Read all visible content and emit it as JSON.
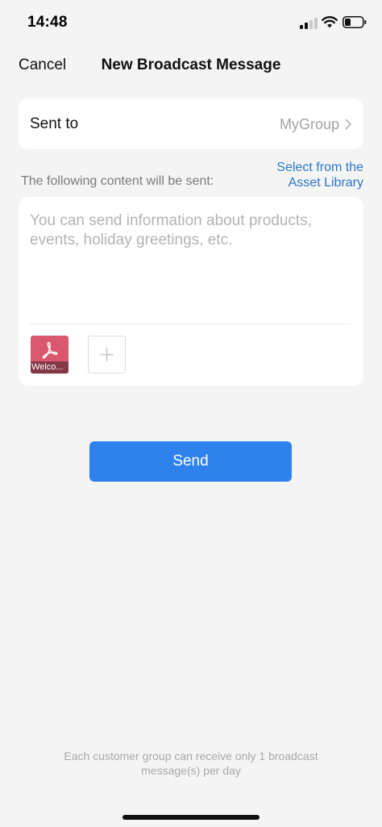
{
  "status_bar": {
    "time": "14:48",
    "icons": [
      "cellular-signal-icon",
      "wifi-icon",
      "battery-icon"
    ]
  },
  "nav": {
    "cancel_label": "Cancel",
    "title": "New Broadcast Message"
  },
  "recipient": {
    "label": "Sent to",
    "value": "MyGroup",
    "icon": "chevron-right-icon"
  },
  "content_section": {
    "label": "The following content will be sent:",
    "asset_link_line1": "Select from the",
    "asset_link_line2": "Asset Library"
  },
  "message": {
    "value": "",
    "placeholder": "You can send information about products, events, holiday greetings, etc."
  },
  "attachments": {
    "items": [
      {
        "type": "pdf",
        "icon": "pdf-icon",
        "label": "Welco..."
      }
    ],
    "add_icon": "plus-icon"
  },
  "send_label": "Send",
  "footer_note": "Each customer group can receive only 1 broadcast message(s) per day",
  "colors": {
    "background": "#f4f4f4",
    "card": "#ffffff",
    "accent_button": "#2f81ec",
    "link": "#2a77c9",
    "attachment_thumb": "#d9586e",
    "muted_text": "#a3a3a3"
  }
}
